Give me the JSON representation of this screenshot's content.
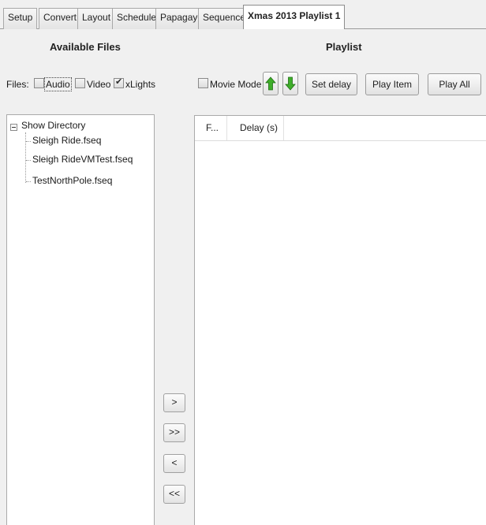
{
  "tabs": [
    {
      "label": "Setup"
    },
    {
      "label": "Convert"
    },
    {
      "label": "Layout"
    },
    {
      "label": "Schedule"
    },
    {
      "label": "Papagayo"
    },
    {
      "label": "Sequencer"
    },
    {
      "label": "Xmas 2013 Playlist 1"
    }
  ],
  "available_files": {
    "title": "Available Files",
    "files_label": "Files:",
    "filters": [
      {
        "label": "Audio",
        "checked": false
      },
      {
        "label": "Video",
        "checked": false
      },
      {
        "label": "xLights",
        "checked": true
      }
    ]
  },
  "tree": {
    "root": "Show Directory",
    "items": [
      "Sleigh Ride.fseq",
      "Sleigh RideVMTest.fseq",
      "TestNorthPole.fseq"
    ]
  },
  "move_buttons": {
    "add": ">",
    "add_all": ">>",
    "remove": "<",
    "remove_all": "<<"
  },
  "playlist": {
    "title": "Playlist",
    "movie_mode_label": "Movie Mode",
    "movie_mode_checked": false,
    "set_delay": "Set delay",
    "play_item": "Play Item",
    "play_all": "Play All",
    "columns": [
      "F...",
      "Delay (s)"
    ],
    "arrow_up_color": "#3fae2a",
    "arrow_down_color": "#3fae2a"
  }
}
